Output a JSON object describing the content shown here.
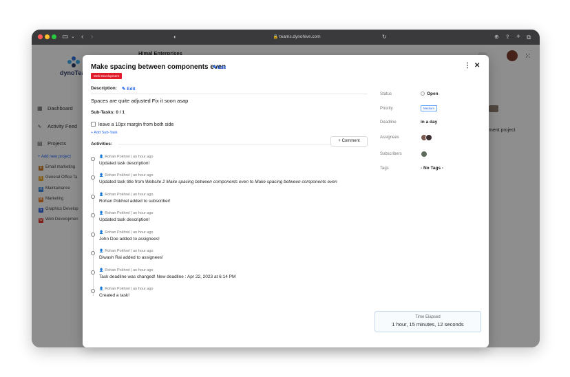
{
  "browser": {
    "url": "teams.dynohive.com"
  },
  "app": {
    "logo_text": "dynoTeam",
    "org_name": "Himal Enterprises",
    "nav": [
      {
        "label": "Dashboard",
        "icon": "grid-icon"
      },
      {
        "label": "Activity Feed",
        "icon": "activity-icon"
      },
      {
        "label": "Projects",
        "icon": "folder-icon"
      }
    ],
    "add_project_label": "+ Add new project",
    "projects": [
      {
        "label": "Email marketing",
        "letter": "E",
        "color": "#c2772e"
      },
      {
        "label": "General Office Ta",
        "letter": "G",
        "color": "#e0a22a"
      },
      {
        "label": "Maintainance",
        "letter": "M",
        "color": "#2f7fd8"
      },
      {
        "label": "Marketing",
        "letter": "M",
        "color": "#e07b2a"
      },
      {
        "label": "Graphics Develop",
        "letter": "G",
        "color": "#2f63d8"
      },
      {
        "label": "Web Developmen",
        "letter": "W",
        "color": "#d63a2a"
      }
    ],
    "background_right_text": "ment project"
  },
  "modal": {
    "title": "Make spacing between components even",
    "edit_label": "Edit",
    "tag": "Web Development",
    "description_label": "Description:",
    "description_edit_label": "Edit",
    "description_text": "Spaces are quite adjusted Fix it soon asap",
    "subtasks_label": "Sub-Tasks:",
    "subtasks_count": "0 / 1",
    "subtask_item": "leave a 10px margin from both side",
    "add_subtask_label": "+ Add Sub-Task",
    "activities_label": "Activities:",
    "comment_button": "+ Comment",
    "activities": [
      {
        "user": "Rohan Pokhrel",
        "time": "an hour ago",
        "msg": "Updated task description!"
      },
      {
        "user": "Rohan Pokhrel",
        "time": "an hour ago",
        "msg_pre": "Updated task title from ",
        "msg_old": "Website 2 Make spacing between components even",
        "msg_mid": " to ",
        "msg_new": "Make spacing between components even"
      },
      {
        "user": "Rohan Pokhrel",
        "time": "an hour ago",
        "msg": "Rohan Pokhrel added to subscriber!"
      },
      {
        "user": "Rohan Pokhrel",
        "time": "an hour ago",
        "msg": "Updated task description!"
      },
      {
        "user": "Rohan Pokhrel",
        "time": "an hour ago",
        "msg": "John Doe added to assignees!"
      },
      {
        "user": "Rohan Pokhrel",
        "time": "an hour ago",
        "msg": "Diwash Rai added to assignees!"
      },
      {
        "user": "Rohan Pokhrel",
        "time": "an hour ago",
        "msg": "Task deadline was changed! New deadline : Apr 22, 2023 at 6:14 PM"
      },
      {
        "user": "Rohan Pokhrel",
        "time": "an hour ago",
        "msg": "Created a task!"
      }
    ],
    "details": {
      "status_label": "Status",
      "status_value": "Open",
      "priority_label": "Priority",
      "priority_value": "Medium",
      "deadline_label": "Deadline",
      "deadline_value": "in a day",
      "assignees_label": "Assignees",
      "subscribers_label": "Subscribers",
      "tags_label": "Tags",
      "tags_value": "- No Tags -"
    },
    "time_elapsed_label": "Time Elapsed",
    "time_elapsed_value": "1 hour, 15 minutes, 12 seconds"
  }
}
